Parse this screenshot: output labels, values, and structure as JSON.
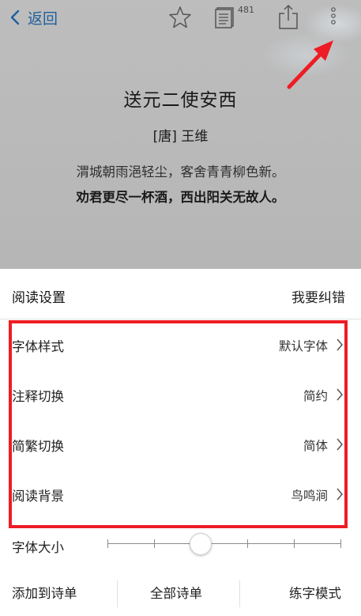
{
  "nav": {
    "back_label": "返回",
    "list_count": "481",
    "icons": [
      "chevron-left-icon",
      "star-icon",
      "list-icon",
      "share-icon",
      "more-icon"
    ]
  },
  "poem": {
    "title": "送元二使安西",
    "author": "[唐] 王维",
    "line1": "渭城朝雨浥轻尘，客舍青青柳色新。",
    "line2": "劝君更尽一杯酒，西出阳关无故人。"
  },
  "settings": {
    "title": "阅读设置",
    "report_label": "我要纠错",
    "rows": [
      {
        "label": "字体样式",
        "value": "默认字体"
      },
      {
        "label": "注释切换",
        "value": "简约"
      },
      {
        "label": "简繁切换",
        "value": "简体"
      },
      {
        "label": "阅读背景",
        "value": "鸟鸣涧"
      }
    ],
    "font_size": {
      "label": "字体大小",
      "steps": 6,
      "selected_step": 2
    }
  },
  "bottom_bar": {
    "add_label": "添加到诗单",
    "all_label": "全部诗单",
    "practice_label": "练字模式"
  },
  "colors": {
    "accent_blue": "#1f5f9c",
    "annotation_red": "#ee1c24",
    "overlay_gray": "#b9b9b9"
  }
}
